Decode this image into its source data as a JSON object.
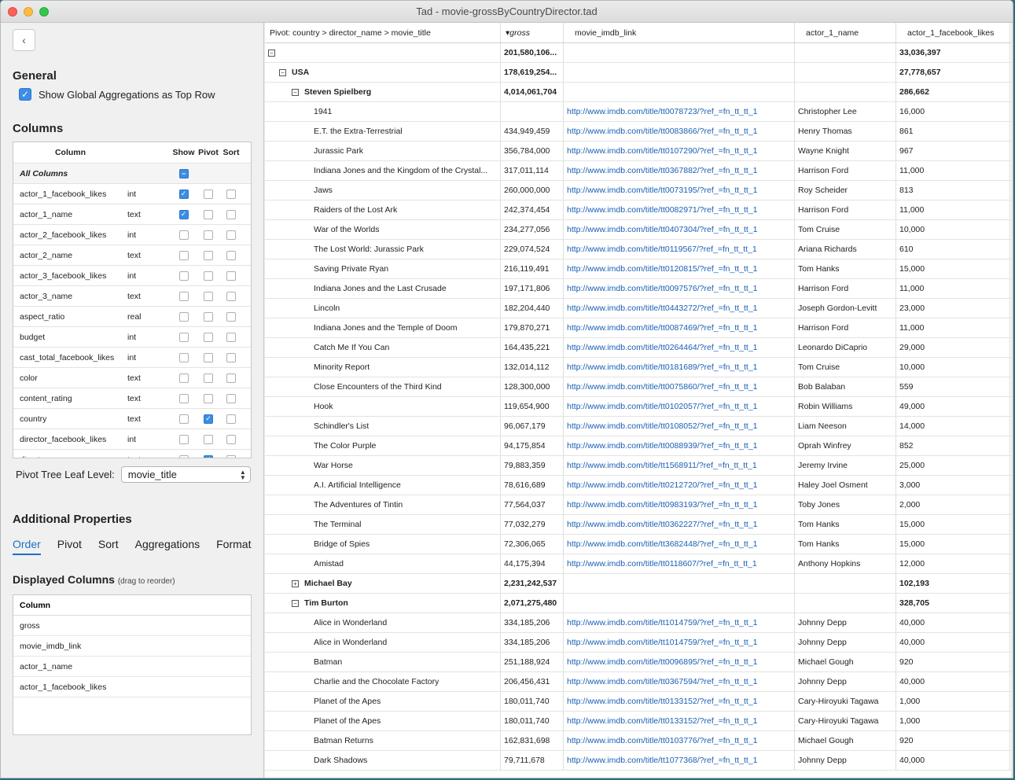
{
  "window": {
    "title": "Tad - movie-grossByCountryDirector.tad"
  },
  "sidebar": {
    "back_label": "‹",
    "general_title": "General",
    "global_agg_label": "Show Global Aggregations as Top Row",
    "columns_title": "Columns",
    "cols_header": {
      "column": "Column",
      "show": "Show",
      "pivot": "Pivot",
      "sort": "Sort"
    },
    "all_columns_label": "All Columns",
    "columns": [
      {
        "name": "actor_1_facebook_likes",
        "type": "int",
        "show": true,
        "pivot": false,
        "sort": false
      },
      {
        "name": "actor_1_name",
        "type": "text",
        "show": true,
        "pivot": false,
        "sort": false
      },
      {
        "name": "actor_2_facebook_likes",
        "type": "int",
        "show": false,
        "pivot": false,
        "sort": false
      },
      {
        "name": "actor_2_name",
        "type": "text",
        "show": false,
        "pivot": false,
        "sort": false
      },
      {
        "name": "actor_3_facebook_likes",
        "type": "int",
        "show": false,
        "pivot": false,
        "sort": false
      },
      {
        "name": "actor_3_name",
        "type": "text",
        "show": false,
        "pivot": false,
        "sort": false
      },
      {
        "name": "aspect_ratio",
        "type": "real",
        "show": false,
        "pivot": false,
        "sort": false
      },
      {
        "name": "budget",
        "type": "int",
        "show": false,
        "pivot": false,
        "sort": false
      },
      {
        "name": "cast_total_facebook_likes",
        "type": "int",
        "show": false,
        "pivot": false,
        "sort": false
      },
      {
        "name": "color",
        "type": "text",
        "show": false,
        "pivot": false,
        "sort": false
      },
      {
        "name": "content_rating",
        "type": "text",
        "show": false,
        "pivot": false,
        "sort": false
      },
      {
        "name": "country",
        "type": "text",
        "show": false,
        "pivot": true,
        "sort": false
      },
      {
        "name": "director_facebook_likes",
        "type": "int",
        "show": false,
        "pivot": false,
        "sort": false
      },
      {
        "name": "director_name",
        "type": "text",
        "show": false,
        "pivot": true,
        "sort": false
      }
    ],
    "leaf_label": "Pivot Tree Leaf Level:",
    "leaf_value": "movie_title",
    "additional_title": "Additional Properties",
    "tabs": [
      "Order",
      "Pivot",
      "Sort",
      "Aggregations",
      "Format"
    ],
    "displayed_title": "Displayed Columns",
    "displayed_hint": "(drag to reorder)",
    "displayed_header": "Column",
    "displayed_columns": [
      "gross",
      "movie_imdb_link",
      "actor_1_name",
      "actor_1_facebook_likes"
    ]
  },
  "grid": {
    "headers": [
      "Pivot: country > director_name > movie_title",
      "gross",
      "movie_imdb_link",
      "actor_1_name",
      "actor_1_facebook_likes"
    ],
    "sort_indicator": "▾",
    "rows": [
      {
        "level": 0,
        "toggle": "−",
        "label": "",
        "gross": "201,580,106...",
        "link": "",
        "actor": "",
        "likes": "33,036,397",
        "bold": true
      },
      {
        "level": 1,
        "toggle": "−",
        "label": "USA",
        "gross": "178,619,254...",
        "link": "",
        "actor": "",
        "likes": "27,778,657",
        "bold": true
      },
      {
        "level": 2,
        "toggle": "−",
        "label": "Steven Spielberg",
        "gross": "4,014,061,704",
        "link": "",
        "actor": "",
        "likes": "286,662",
        "bold": true
      },
      {
        "level": 3,
        "label": "1941",
        "gross": "",
        "link": "http://www.imdb.com/title/tt0078723/?ref_=fn_tt_tt_1",
        "actor": "Christopher Lee",
        "likes": "16,000"
      },
      {
        "level": 3,
        "label": "E.T. the Extra-Terrestrial",
        "gross": "434,949,459",
        "link": "http://www.imdb.com/title/tt0083866/?ref_=fn_tt_tt_1",
        "actor": "Henry Thomas",
        "likes": "861"
      },
      {
        "level": 3,
        "label": "Jurassic Park",
        "gross": "356,784,000",
        "link": "http://www.imdb.com/title/tt0107290/?ref_=fn_tt_tt_1",
        "actor": "Wayne Knight",
        "likes": "967"
      },
      {
        "level": 3,
        "label": "Indiana Jones and the Kingdom of the Crystal...",
        "gross": "317,011,114",
        "link": "http://www.imdb.com/title/tt0367882/?ref_=fn_tt_tt_1",
        "actor": "Harrison Ford",
        "likes": "11,000"
      },
      {
        "level": 3,
        "label": "Jaws",
        "gross": "260,000,000",
        "link": "http://www.imdb.com/title/tt0073195/?ref_=fn_tt_tt_1",
        "actor": "Roy Scheider",
        "likes": "813"
      },
      {
        "level": 3,
        "label": "Raiders of the Lost Ark",
        "gross": "242,374,454",
        "link": "http://www.imdb.com/title/tt0082971/?ref_=fn_tt_tt_1",
        "actor": "Harrison Ford",
        "likes": "11,000"
      },
      {
        "level": 3,
        "label": "War of the Worlds",
        "gross": "234,277,056",
        "link": "http://www.imdb.com/title/tt0407304/?ref_=fn_tt_tt_1",
        "actor": "Tom Cruise",
        "likes": "10,000"
      },
      {
        "level": 3,
        "label": "The Lost World: Jurassic Park",
        "gross": "229,074,524",
        "link": "http://www.imdb.com/title/tt0119567/?ref_=fn_tt_tt_1",
        "actor": "Ariana Richards",
        "likes": "610"
      },
      {
        "level": 3,
        "label": "Saving Private Ryan",
        "gross": "216,119,491",
        "link": "http://www.imdb.com/title/tt0120815/?ref_=fn_tt_tt_1",
        "actor": "Tom Hanks",
        "likes": "15,000"
      },
      {
        "level": 3,
        "label": "Indiana Jones and the Last Crusade",
        "gross": "197,171,806",
        "link": "http://www.imdb.com/title/tt0097576/?ref_=fn_tt_tt_1",
        "actor": "Harrison Ford",
        "likes": "11,000"
      },
      {
        "level": 3,
        "label": "Lincoln",
        "gross": "182,204,440",
        "link": "http://www.imdb.com/title/tt0443272/?ref_=fn_tt_tt_1",
        "actor": "Joseph Gordon-Levitt",
        "likes": "23,000"
      },
      {
        "level": 3,
        "label": "Indiana Jones and the Temple of Doom",
        "gross": "179,870,271",
        "link": "http://www.imdb.com/title/tt0087469/?ref_=fn_tt_tt_1",
        "actor": "Harrison Ford",
        "likes": "11,000"
      },
      {
        "level": 3,
        "label": "Catch Me If You Can",
        "gross": "164,435,221",
        "link": "http://www.imdb.com/title/tt0264464/?ref_=fn_tt_tt_1",
        "actor": "Leonardo DiCaprio",
        "likes": "29,000"
      },
      {
        "level": 3,
        "label": "Minority Report",
        "gross": "132,014,112",
        "link": "http://www.imdb.com/title/tt0181689/?ref_=fn_tt_tt_1",
        "actor": "Tom Cruise",
        "likes": "10,000"
      },
      {
        "level": 3,
        "label": "Close Encounters of the Third Kind",
        "gross": "128,300,000",
        "link": "http://www.imdb.com/title/tt0075860/?ref_=fn_tt_tt_1",
        "actor": "Bob Balaban",
        "likes": "559"
      },
      {
        "level": 3,
        "label": "Hook",
        "gross": "119,654,900",
        "link": "http://www.imdb.com/title/tt0102057/?ref_=fn_tt_tt_1",
        "actor": "Robin Williams",
        "likes": "49,000"
      },
      {
        "level": 3,
        "label": "Schindler's List",
        "gross": "96,067,179",
        "link": "http://www.imdb.com/title/tt0108052/?ref_=fn_tt_tt_1",
        "actor": "Liam Neeson",
        "likes": "14,000"
      },
      {
        "level": 3,
        "label": "The Color Purple",
        "gross": "94,175,854",
        "link": "http://www.imdb.com/title/tt0088939/?ref_=fn_tt_tt_1",
        "actor": "Oprah Winfrey",
        "likes": "852"
      },
      {
        "level": 3,
        "label": "War Horse",
        "gross": "79,883,359",
        "link": "http://www.imdb.com/title/tt1568911/?ref_=fn_tt_tt_1",
        "actor": "Jeremy Irvine",
        "likes": "25,000"
      },
      {
        "level": 3,
        "label": "A.I. Artificial Intelligence",
        "gross": "78,616,689",
        "link": "http://www.imdb.com/title/tt0212720/?ref_=fn_tt_tt_1",
        "actor": "Haley Joel Osment",
        "likes": "3,000"
      },
      {
        "level": 3,
        "label": "The Adventures of Tintin",
        "gross": "77,564,037",
        "link": "http://www.imdb.com/title/tt0983193/?ref_=fn_tt_tt_1",
        "actor": "Toby Jones",
        "likes": "2,000"
      },
      {
        "level": 3,
        "label": "The Terminal",
        "gross": "77,032,279",
        "link": "http://www.imdb.com/title/tt0362227/?ref_=fn_tt_tt_1",
        "actor": "Tom Hanks",
        "likes": "15,000"
      },
      {
        "level": 3,
        "label": "Bridge of Spies",
        "gross": "72,306,065",
        "link": "http://www.imdb.com/title/tt3682448/?ref_=fn_tt_tt_1",
        "actor": "Tom Hanks",
        "likes": "15,000"
      },
      {
        "level": 3,
        "label": "Amistad",
        "gross": "44,175,394",
        "link": "http://www.imdb.com/title/tt0118607/?ref_=fn_tt_tt_1",
        "actor": "Anthony Hopkins",
        "likes": "12,000"
      },
      {
        "level": 2,
        "toggle": "+",
        "label": "Michael Bay",
        "gross": "2,231,242,537",
        "link": "",
        "actor": "",
        "likes": "102,193",
        "bold": true
      },
      {
        "level": 2,
        "toggle": "−",
        "label": "Tim Burton",
        "gross": "2,071,275,480",
        "link": "",
        "actor": "",
        "likes": "328,705",
        "bold": true
      },
      {
        "level": 3,
        "label": "Alice in Wonderland",
        "gross": "334,185,206",
        "link": "http://www.imdb.com/title/tt1014759/?ref_=fn_tt_tt_1",
        "actor": "Johnny Depp",
        "likes": "40,000"
      },
      {
        "level": 3,
        "label": "Alice in Wonderland",
        "gross": "334,185,206",
        "link": "http://www.imdb.com/title/tt1014759/?ref_=fn_tt_tt_1",
        "actor": "Johnny Depp",
        "likes": "40,000"
      },
      {
        "level": 3,
        "label": "Batman",
        "gross": "251,188,924",
        "link": "http://www.imdb.com/title/tt0096895/?ref_=fn_tt_tt_1",
        "actor": "Michael Gough",
        "likes": "920"
      },
      {
        "level": 3,
        "label": "Charlie and the Chocolate Factory",
        "gross": "206,456,431",
        "link": "http://www.imdb.com/title/tt0367594/?ref_=fn_tt_tt_1",
        "actor": "Johnny Depp",
        "likes": "40,000"
      },
      {
        "level": 3,
        "label": "Planet of the Apes",
        "gross": "180,011,740",
        "link": "http://www.imdb.com/title/tt0133152/?ref_=fn_tt_tt_1",
        "actor": "Cary-Hiroyuki Tagawa",
        "likes": "1,000"
      },
      {
        "level": 3,
        "label": "Planet of the Apes",
        "gross": "180,011,740",
        "link": "http://www.imdb.com/title/tt0133152/?ref_=fn_tt_tt_1",
        "actor": "Cary-Hiroyuki Tagawa",
        "likes": "1,000"
      },
      {
        "level": 3,
        "label": "Batman Returns",
        "gross": "162,831,698",
        "link": "http://www.imdb.com/title/tt0103776/?ref_=fn_tt_tt_1",
        "actor": "Michael Gough",
        "likes": "920"
      },
      {
        "level": 3,
        "label": "Dark Shadows",
        "gross": "79,711,678",
        "link": "http://www.imdb.com/title/tt1077368/?ref_=fn_tt_tt_1",
        "actor": "Johnny Depp",
        "likes": "40,000"
      }
    ]
  }
}
